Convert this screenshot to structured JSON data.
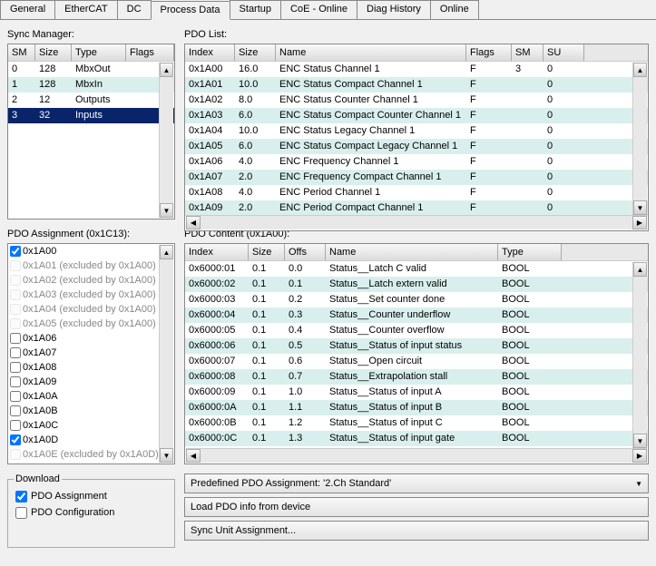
{
  "tabs": [
    "General",
    "EtherCAT",
    "DC",
    "Process Data",
    "Startup",
    "CoE - Online",
    "Diag History",
    "Online"
  ],
  "activeTab": 3,
  "labels": {
    "syncManager": "Sync Manager:",
    "pdoList": "PDO List:",
    "pdoAssignment": "PDO Assignment (0x1C13):",
    "pdoContent": "PDO Content (0x1A00):",
    "download": "Download",
    "pdoAssignmentChk": "PDO Assignment",
    "pdoConfigChk": "PDO Configuration",
    "predefined": "Predefined PDO Assignment: '2.Ch Standard'",
    "loadPdo": "Load PDO info from device",
    "syncUnit": "Sync Unit Assignment..."
  },
  "syncManager": {
    "headers": [
      "SM",
      "Size",
      "Type",
      "Flags"
    ],
    "rows": [
      {
        "sm": "0",
        "size": "128",
        "type": "MbxOut",
        "flags": "",
        "sel": false,
        "alt": false
      },
      {
        "sm": "1",
        "size": "128",
        "type": "MbxIn",
        "flags": "",
        "sel": false,
        "alt": true
      },
      {
        "sm": "2",
        "size": "12",
        "type": "Outputs",
        "flags": "",
        "sel": false,
        "alt": false
      },
      {
        "sm": "3",
        "size": "32",
        "type": "Inputs",
        "flags": "",
        "sel": true,
        "alt": false
      }
    ]
  },
  "pdoList": {
    "headers": [
      "Index",
      "Size",
      "Name",
      "Flags",
      "SM",
      "SU"
    ],
    "rows": [
      {
        "index": "0x1A00",
        "size": "16.0",
        "name": "ENC Status Channel 1",
        "flags": "F",
        "sm": "3",
        "su": "0",
        "alt": false
      },
      {
        "index": "0x1A01",
        "size": "10.0",
        "name": "ENC Status Compact Channel 1",
        "flags": "F",
        "sm": "",
        "su": "0",
        "alt": true
      },
      {
        "index": "0x1A02",
        "size": "8.0",
        "name": "ENC Status Counter Channel 1",
        "flags": "F",
        "sm": "",
        "su": "0",
        "alt": false
      },
      {
        "index": "0x1A03",
        "size": "6.0",
        "name": "ENC Status Compact Counter Channel 1",
        "flags": "F",
        "sm": "",
        "su": "0",
        "alt": true
      },
      {
        "index": "0x1A04",
        "size": "10.0",
        "name": "ENC Status Legacy Channel 1",
        "flags": "F",
        "sm": "",
        "su": "0",
        "alt": false
      },
      {
        "index": "0x1A05",
        "size": "6.0",
        "name": "ENC Status Compact Legacy Channel 1",
        "flags": "F",
        "sm": "",
        "su": "0",
        "alt": true
      },
      {
        "index": "0x1A06",
        "size": "4.0",
        "name": "ENC Frequency Channel 1",
        "flags": "F",
        "sm": "",
        "su": "0",
        "alt": false
      },
      {
        "index": "0x1A07",
        "size": "2.0",
        "name": "ENC Frequency Compact Channel 1",
        "flags": "F",
        "sm": "",
        "su": "0",
        "alt": true
      },
      {
        "index": "0x1A08",
        "size": "4.0",
        "name": "ENC Period Channel 1",
        "flags": "F",
        "sm": "",
        "su": "0",
        "alt": false
      },
      {
        "index": "0x1A09",
        "size": "2.0",
        "name": "ENC Period Compact Channel 1",
        "flags": "F",
        "sm": "",
        "su": "0",
        "alt": true
      }
    ]
  },
  "pdoAssignment": {
    "items": [
      {
        "label": "0x1A00",
        "checked": true,
        "excluded": false
      },
      {
        "label": "0x1A01 (excluded by 0x1A00)",
        "checked": false,
        "excluded": true
      },
      {
        "label": "0x1A02 (excluded by 0x1A00)",
        "checked": false,
        "excluded": true
      },
      {
        "label": "0x1A03 (excluded by 0x1A00)",
        "checked": false,
        "excluded": true
      },
      {
        "label": "0x1A04 (excluded by 0x1A00)",
        "checked": false,
        "excluded": true
      },
      {
        "label": "0x1A05 (excluded by 0x1A00)",
        "checked": false,
        "excluded": true
      },
      {
        "label": "0x1A06",
        "checked": false,
        "excluded": false
      },
      {
        "label": "0x1A07",
        "checked": false,
        "excluded": false
      },
      {
        "label": "0x1A08",
        "checked": false,
        "excluded": false
      },
      {
        "label": "0x1A09",
        "checked": false,
        "excluded": false
      },
      {
        "label": "0x1A0A",
        "checked": false,
        "excluded": false
      },
      {
        "label": "0x1A0B",
        "checked": false,
        "excluded": false
      },
      {
        "label": "0x1A0C",
        "checked": false,
        "excluded": false
      },
      {
        "label": "0x1A0D",
        "checked": true,
        "excluded": false
      },
      {
        "label": "0x1A0E (excluded by 0x1A0D)",
        "checked": false,
        "excluded": true
      }
    ]
  },
  "pdoContent": {
    "headers": [
      "Index",
      "Size",
      "Offs",
      "Name",
      "Type"
    ],
    "rows": [
      {
        "index": "0x6000:01",
        "size": "0.1",
        "offs": "0.0",
        "name": "Status__Latch C valid",
        "type": "BOOL",
        "alt": false
      },
      {
        "index": "0x6000:02",
        "size": "0.1",
        "offs": "0.1",
        "name": "Status__Latch extern valid",
        "type": "BOOL",
        "alt": true
      },
      {
        "index": "0x6000:03",
        "size": "0.1",
        "offs": "0.2",
        "name": "Status__Set counter done",
        "type": "BOOL",
        "alt": false
      },
      {
        "index": "0x6000:04",
        "size": "0.1",
        "offs": "0.3",
        "name": "Status__Counter underflow",
        "type": "BOOL",
        "alt": true
      },
      {
        "index": "0x6000:05",
        "size": "0.1",
        "offs": "0.4",
        "name": "Status__Counter overflow",
        "type": "BOOL",
        "alt": false
      },
      {
        "index": "0x6000:06",
        "size": "0.1",
        "offs": "0.5",
        "name": "Status__Status of input status",
        "type": "BOOL",
        "alt": true
      },
      {
        "index": "0x6000:07",
        "size": "0.1",
        "offs": "0.6",
        "name": "Status__Open circuit",
        "type": "BOOL",
        "alt": false
      },
      {
        "index": "0x6000:08",
        "size": "0.1",
        "offs": "0.7",
        "name": "Status__Extrapolation stall",
        "type": "BOOL",
        "alt": true
      },
      {
        "index": "0x6000:09",
        "size": "0.1",
        "offs": "1.0",
        "name": "Status__Status of input A",
        "type": "BOOL",
        "alt": false
      },
      {
        "index": "0x6000:0A",
        "size": "0.1",
        "offs": "1.1",
        "name": "Status__Status of input B",
        "type": "BOOL",
        "alt": true
      },
      {
        "index": "0x6000:0B",
        "size": "0.1",
        "offs": "1.2",
        "name": "Status__Status of input C",
        "type": "BOOL",
        "alt": false
      },
      {
        "index": "0x6000:0C",
        "size": "0.1",
        "offs": "1.3",
        "name": "Status__Status of input gate",
        "type": "BOOL",
        "alt": true
      }
    ]
  },
  "download": {
    "pdoAssignment": true,
    "pdoConfig": false
  }
}
